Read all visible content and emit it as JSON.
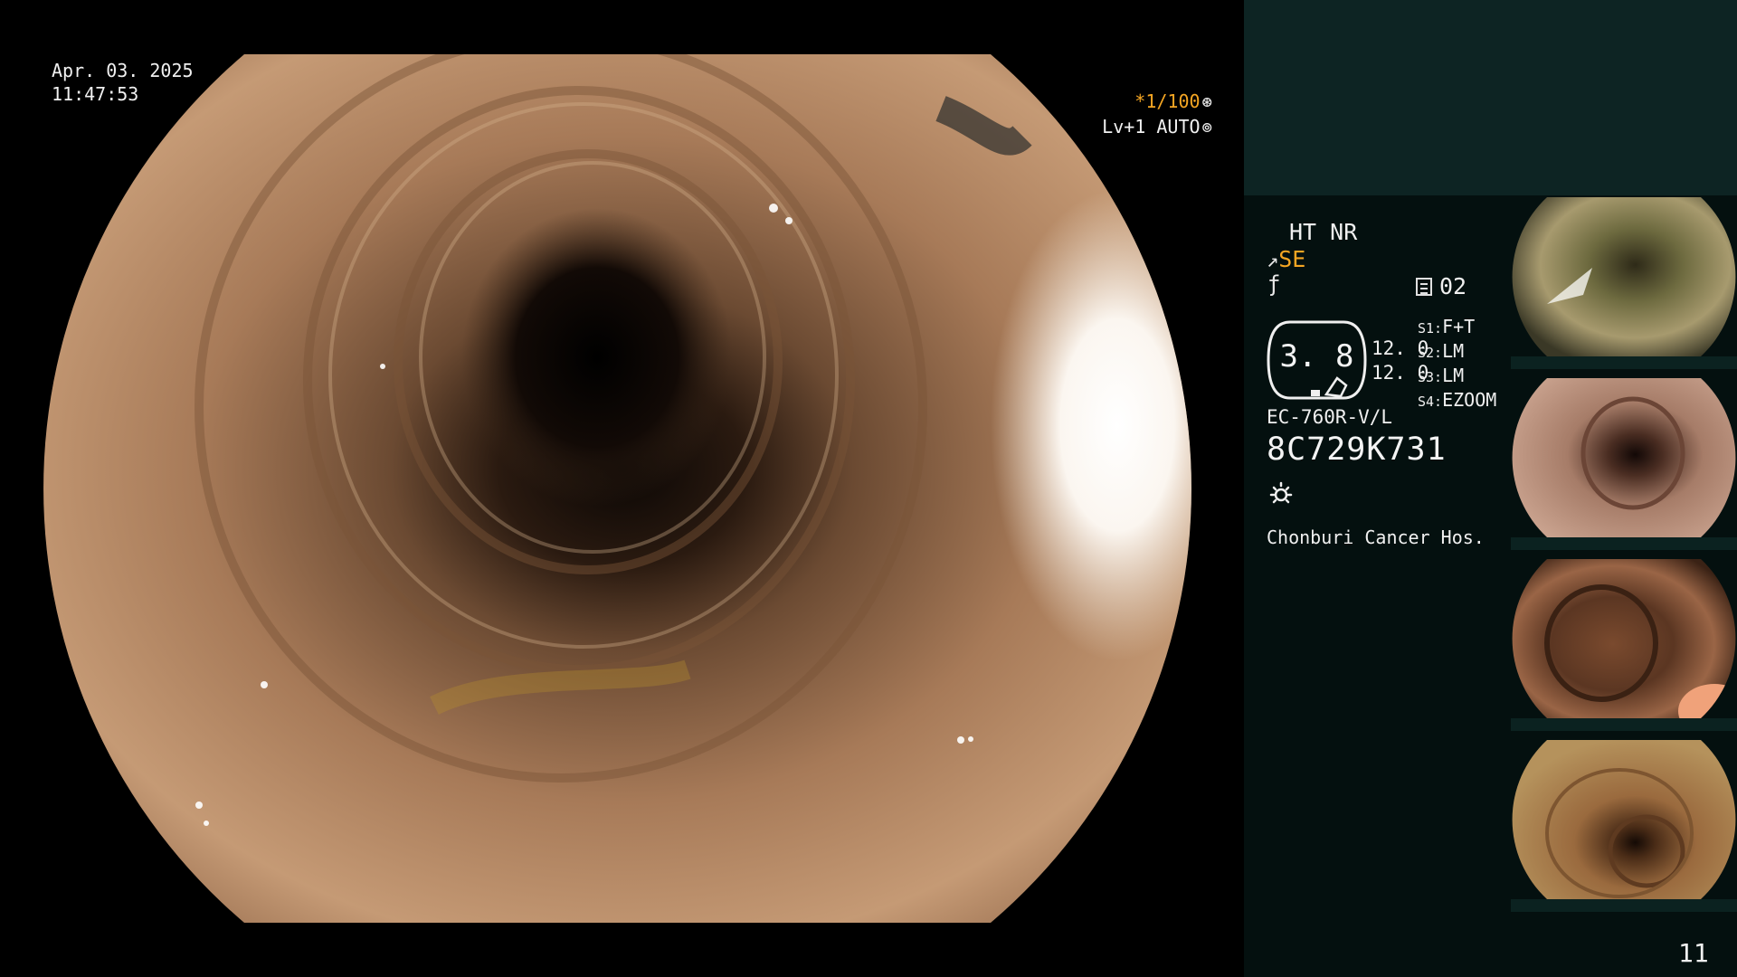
{
  "overlay": {
    "date": "Apr. 03. 2025",
    "time": "11:47:53",
    "shutter": "*1/100",
    "iris": "Lv+1 AUTO"
  },
  "status": {
    "enhancement": "HT NR",
    "structure_mode": "SE",
    "memory_label": "02",
    "gauge_value": "3. 8",
    "sub_value_1": "12. 0",
    "sub_value_2": "12. 0",
    "switches": [
      {
        "key": "S1:",
        "value": "F+T"
      },
      {
        "key": "S2:",
        "value": "LM"
      },
      {
        "key": "S3:",
        "value": "LM"
      },
      {
        "key": "S4:",
        "value": "EZOOM"
      }
    ],
    "scope_model": "EC-760R-V/L",
    "scope_serial": "8C729K731",
    "hospital": "Chonburi Cancer Hos."
  },
  "thumbnails": {
    "count": 4,
    "serial_text": "8C729K731"
  },
  "page_number": "11",
  "colors": {
    "accent": "#f5a623",
    "panel_top": "#0d2423",
    "panel": "#04100f",
    "tissue": "#b98a67"
  },
  "icons": [
    "shutter-icon",
    "iris-icon",
    "structure-hook-icon",
    "freeze-off-icon",
    "memo-icon",
    "light-icon"
  ]
}
